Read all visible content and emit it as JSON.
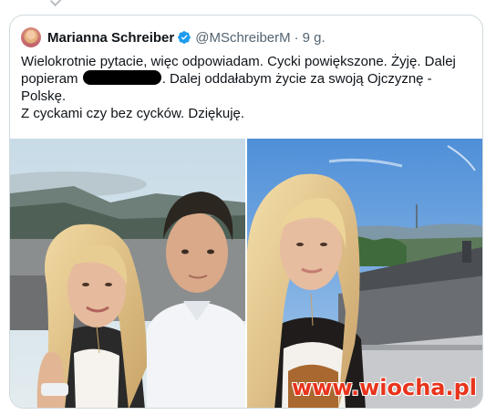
{
  "author": {
    "name": "Marianna Schreiber",
    "handle": "@MSchreiberM",
    "separator": "·",
    "time": "9 g."
  },
  "tweet": {
    "line1": "Wielokrotnie pytacie, więc odpowiadam. Cycki powiększone. Żyję. Dalej",
    "line2_before": "popieram",
    "line2_after": ". Dalej oddałabym życie za swoją Ojczyznę -",
    "line3": "Polskę.",
    "line4": "Z cyckami czy bez cycków. Dziękuję."
  },
  "watermark": "www.wiocha.pl",
  "colors": {
    "verified": "#1d9bf0",
    "border": "#cfd9de",
    "muted": "#536471",
    "watermark": "#e8341c"
  }
}
